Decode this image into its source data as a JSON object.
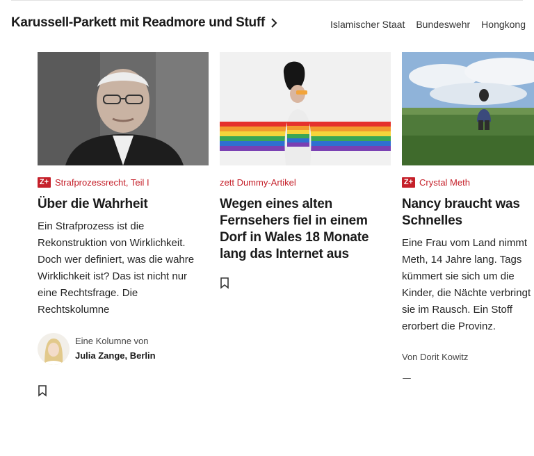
{
  "section": {
    "title": "Karussell-Parkett mit Readmore und Stuff",
    "topics": [
      "Islamischer Staat",
      "Bundeswehr",
      "Hongkong"
    ]
  },
  "cards": [
    {
      "badge": "Z+",
      "kicker": "Strafprozessrecht, Teil I",
      "headline": "Über die Wahrheit",
      "teaser": "Ein Strafprozess ist die Rekonstruktion von Wirklichkeit. Doch wer definiert, was die wahre Wirklichkeit ist? Das ist nicht nur eine Rechtsfrage. Die Rechtskolumne",
      "author_intro": "Eine Kolumne von",
      "author_name": "Julia Zange, Berlin"
    },
    {
      "kicker": "zett Dummy-Artikel",
      "headline": "Wegen eines alten Fernsehers fiel in einem Dorf in Wales 18 Monate lang das Internet aus"
    },
    {
      "badge": "Z+",
      "kicker": "Crystal Meth",
      "headline": "Nancy braucht was Schnelles",
      "teaser": "Eine Frau vom Land nimmt Meth, 14 Jahre lang. Tags kümmert sie sich um die Kinder, die Nächte verbringt sie im Rausch. Ein Stoff erorbert die Provinz.",
      "byline": "Von Dorit Kowitz"
    }
  ],
  "colors": {
    "accent": "#c5202a",
    "text": "#252525"
  },
  "icons": {
    "section_arrow": "chevron-right-icon",
    "bookmark": "bookmark-icon",
    "zplus": "zplus-icon"
  }
}
